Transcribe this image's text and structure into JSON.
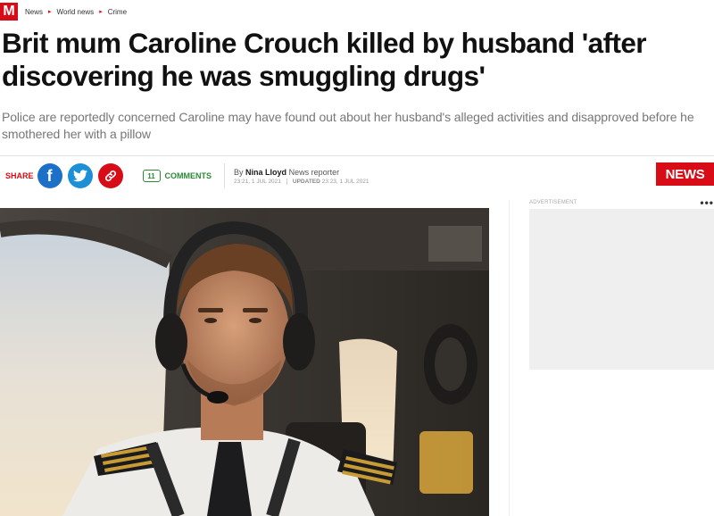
{
  "site": {
    "logo_letter": "M",
    "brand_color": "#d80c17"
  },
  "breadcrumbs": [
    "News",
    "World news",
    "Crime"
  ],
  "article": {
    "headline": "Brit mum Caroline Crouch killed by husband 'after discovering he was smuggling drugs'",
    "standfirst": "Police are reportedly concerned Caroline may have found out about her husband's alleged activities and disapproved before he smothered her with a pillow"
  },
  "share": {
    "label": "SHARE",
    "icons": [
      "facebook-icon",
      "twitter-icon",
      "link-icon"
    ]
  },
  "comments": {
    "count": "11",
    "label": "COMMENTS"
  },
  "byline": {
    "prefix": "By",
    "author": "Nina Lloyd",
    "role": "News reporter",
    "published": "23:21, 1 JUL 2021",
    "updated_label": "UPDATED",
    "updated": "23:23, 1 JUL 2021"
  },
  "section_tag": "NEWS",
  "advert": {
    "label": "ADVERTISEMENT",
    "menu": "•••"
  }
}
